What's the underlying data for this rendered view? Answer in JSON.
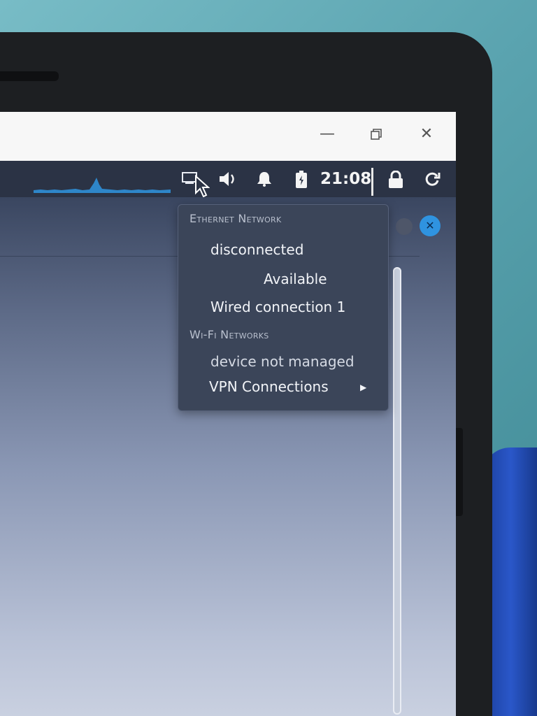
{
  "titlebar": {
    "minimize_icon": "minimize-icon",
    "restore_icon": "restore-icon",
    "close_icon": "close-icon"
  },
  "topbar": {
    "tray_icons": [
      "network-icon",
      "volume-icon",
      "bell-icon",
      "battery-icon",
      "lock-icon",
      "power-icon"
    ],
    "clock": "21:08"
  },
  "network_menu": {
    "ethernet_header": "Ethernet Network",
    "ethernet_status": "disconnected",
    "ethernet_available": "Available",
    "wired_connection": "Wired connection 1",
    "wifi_header": "Wi-Fi Networks",
    "wifi_status": "device not managed",
    "vpn_label": "VPN Connections"
  },
  "colors": {
    "panel_bg": "#2b3345",
    "menu_bg": "#3b4559",
    "accent": "#2f93e0"
  }
}
